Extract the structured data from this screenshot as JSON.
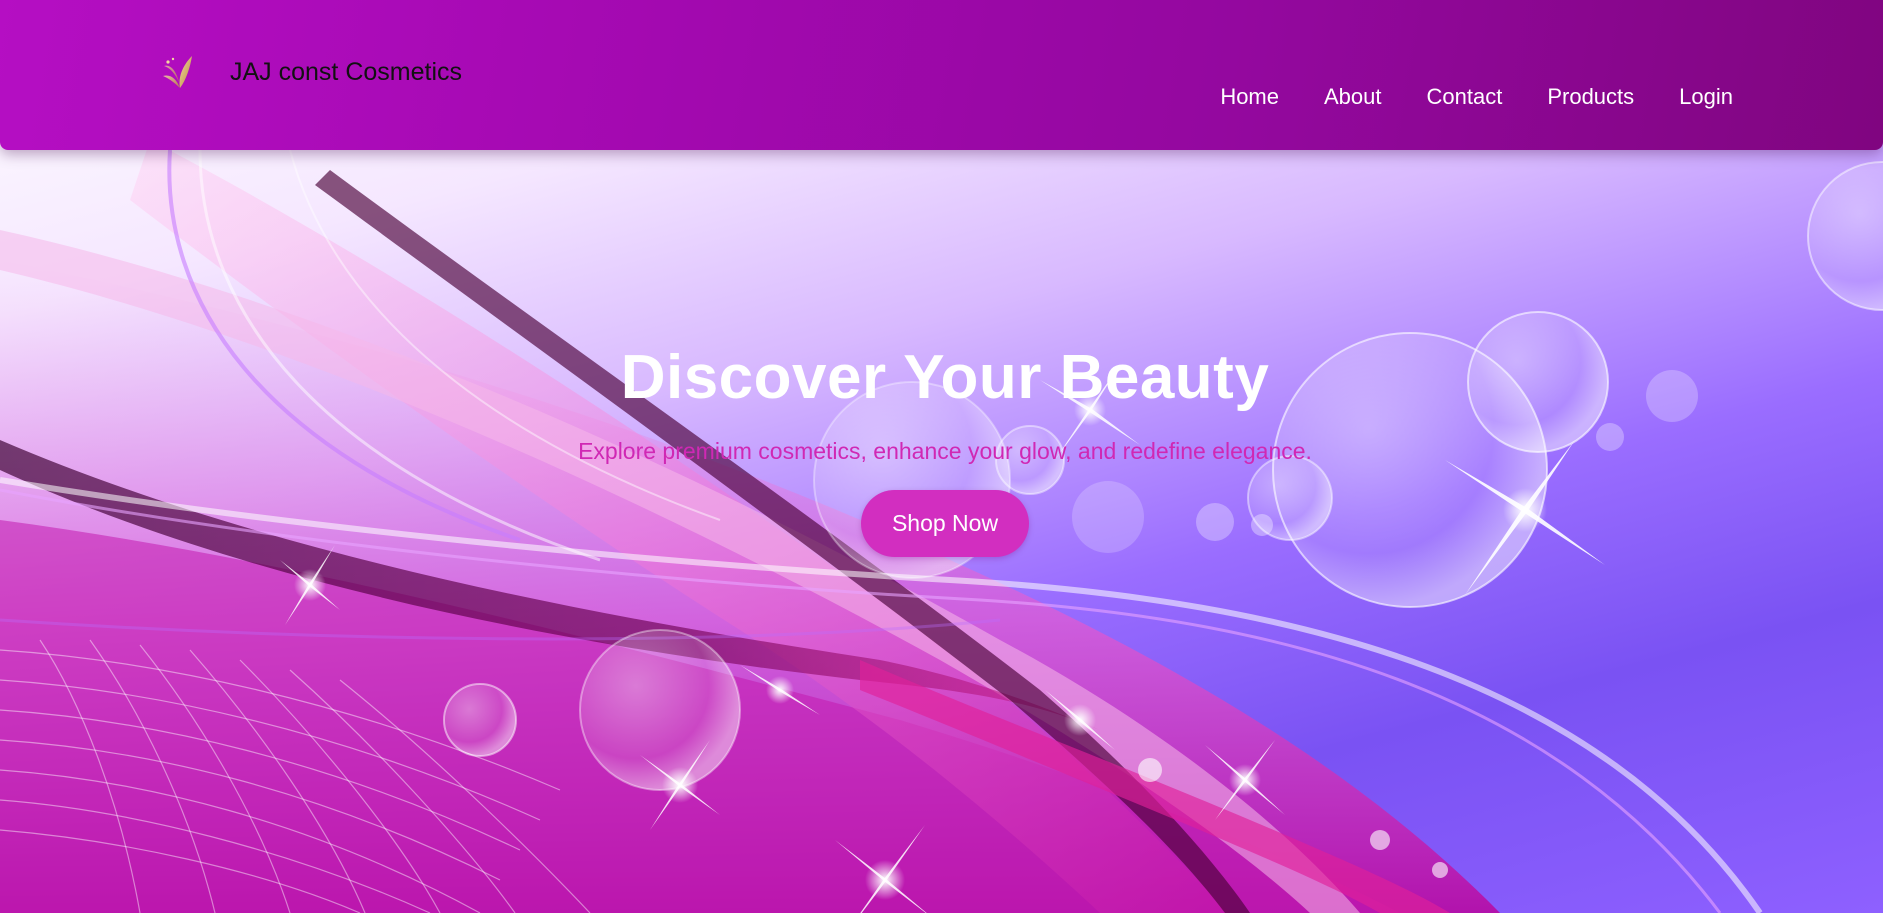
{
  "header": {
    "brand_name": "JAJ const Cosmetics",
    "logo_icon": "butterfly-leaf-logo-icon",
    "nav": [
      {
        "label": "Home"
      },
      {
        "label": "About"
      },
      {
        "label": "Contact"
      },
      {
        "label": "Products"
      },
      {
        "label": "Login"
      }
    ]
  },
  "hero": {
    "title": "Discover Your Beauty",
    "subtitle": "Explore premium cosmetics, enhance your glow, and redefine elegance.",
    "cta_label": "Shop Now"
  },
  "colors": {
    "header_gradient_start": "#b50ec3",
    "header_gradient_end": "#800580",
    "accent": "#d22ec0",
    "subtitle": "#d028b4",
    "hero_purple": "#7a52f3"
  }
}
